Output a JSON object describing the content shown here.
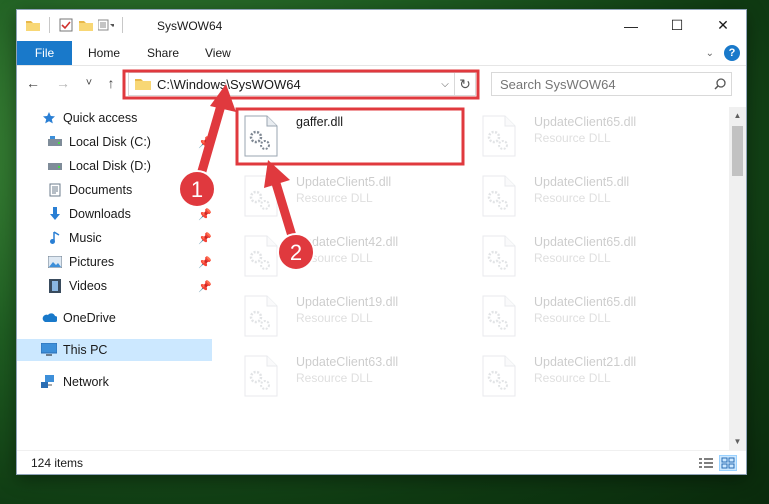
{
  "window": {
    "title": "SysWOW64",
    "controls": {
      "minimize": "—",
      "maximize": "☐",
      "close": "✕"
    }
  },
  "ribbon": {
    "tabs": [
      "File",
      "Home",
      "Share",
      "View"
    ]
  },
  "navigation": {
    "back": "←",
    "forward": "→",
    "recent": "˅",
    "up": "↑",
    "address_path": "C:\\Windows\\SysWOW64",
    "search_placeholder": "Search SysWOW64"
  },
  "sidebar": {
    "items": [
      {
        "label": "Quick access",
        "icon": "star-icon",
        "pinned": false
      },
      {
        "label": "Local Disk (C:)",
        "icon": "drive-icon",
        "pinned": true
      },
      {
        "label": "Local Disk (D:)",
        "icon": "drive-icon",
        "pinned": false
      },
      {
        "label": "Documents",
        "icon": "documents-icon",
        "pinned": true
      },
      {
        "label": "Downloads",
        "icon": "download-icon",
        "pinned": true
      },
      {
        "label": "Music",
        "icon": "music-icon",
        "pinned": true
      },
      {
        "label": "Pictures",
        "icon": "pictures-icon",
        "pinned": true
      },
      {
        "label": "Videos",
        "icon": "videos-icon",
        "pinned": true
      },
      {
        "label": "OneDrive",
        "icon": "cloud-icon",
        "pinned": false
      },
      {
        "label": "This PC",
        "icon": "computer-icon",
        "pinned": false,
        "selected": true
      },
      {
        "label": "Network",
        "icon": "network-icon",
        "pinned": false
      }
    ]
  },
  "files": {
    "left": [
      {
        "name": "gaffer.dll",
        "type": ""
      },
      {
        "name": "UpdateClient5.dll",
        "type": "Resource DLL"
      },
      {
        "name": "UpdateClient42.dll",
        "type": "Resource DLL"
      },
      {
        "name": "UpdateClient19.dll",
        "type": "Resource DLL"
      },
      {
        "name": "UpdateClient63.dll",
        "type": "Resource DLL"
      }
    ],
    "right": [
      {
        "name": "UpdateClient65.dll",
        "type": "Resource DLL"
      },
      {
        "name": "UpdateClient5.dll",
        "type": "Resource DLL"
      },
      {
        "name": "UpdateClient65.dll",
        "type": "Resource DLL"
      },
      {
        "name": "UpdateClient65.dll",
        "type": "Resource DLL"
      },
      {
        "name": "UpdateClient21.dll",
        "type": "Resource DLL"
      }
    ]
  },
  "status": {
    "item_count": "124 items"
  },
  "annotations": {
    "callout_1": "1",
    "callout_2": "2",
    "highlight_color": "#e0393e"
  },
  "colors": {
    "accent": "#1979ca",
    "selection": "#cce8ff"
  }
}
